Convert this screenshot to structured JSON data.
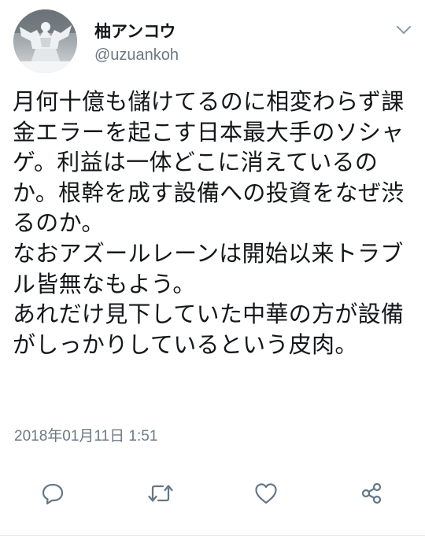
{
  "user": {
    "display_name": "柚アンコウ",
    "handle": "@uzuankoh",
    "avatar_icon": "snow-sculpture-avatar"
  },
  "tweet": {
    "text": "月何十億も儲けてるのに相変わらず課金エラーを起こす日本最大手のソシャゲ。利益は一体どこに消えているのか。根幹を成す設備への投資をなぜ渋るのか。\nなおアズールレーンは開始以来トラブル皆無なもよう。\nあれだけ見下していた中華の方が設備がしっかりしているという皮肉。",
    "timestamp": "2018年01月11日 1:51"
  },
  "actions": {
    "reply_icon": "reply-icon",
    "retweet_icon": "retweet-icon",
    "like_icon": "heart-icon",
    "share_icon": "share-icon",
    "menu_icon": "chevron-down-icon"
  },
  "colors": {
    "text": "#14171a",
    "secondary": "#6b7883",
    "icon": "#657786"
  }
}
